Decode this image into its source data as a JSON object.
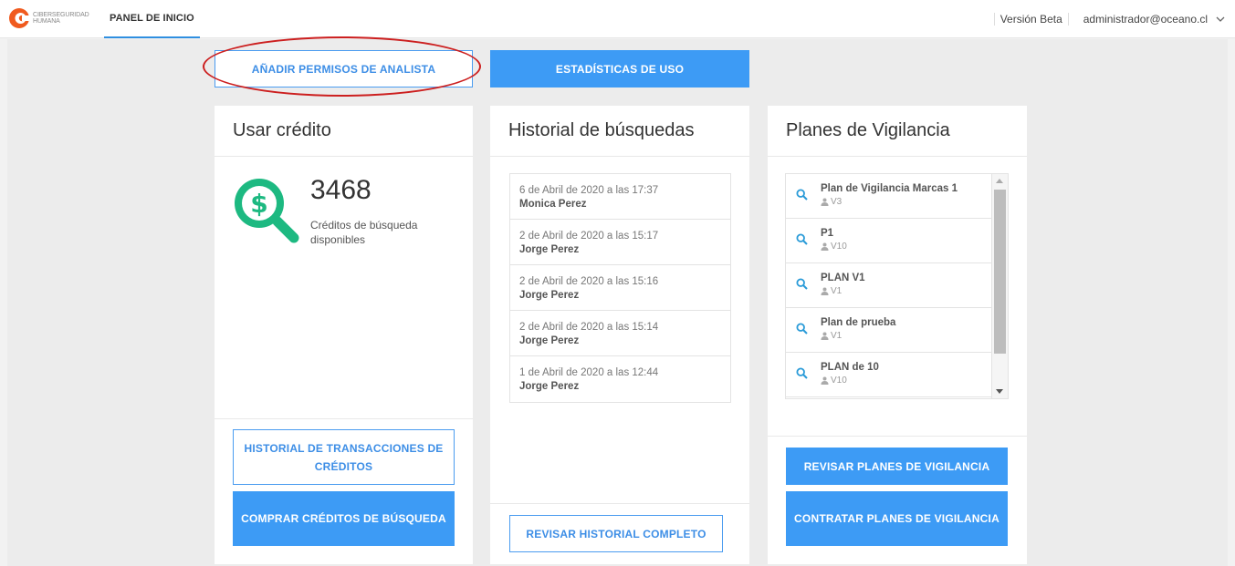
{
  "header": {
    "logo_line1": "CIBERSEGURIDAD",
    "logo_line2": "HUMANA",
    "nav_tab": "PANEL DE INICIO",
    "version": "Versión Beta",
    "user_email": "administrador@oceano.cl"
  },
  "actions": {
    "add_analyst": "AÑADIR PERMISOS DE ANALISTA",
    "usage_stats": "ESTADÍSTICAS DE USO"
  },
  "credit_card": {
    "title": "Usar crédito",
    "amount": "3468",
    "description": "Créditos de búsqueda disponibles",
    "history_button": "HISTORIAL DE TRANSACCIONES DE CRÉDITOS",
    "buy_button": "COMPRAR CRÉDITOS DE BÚSQUEDA"
  },
  "history_card": {
    "title": "Historial de búsquedas",
    "items": [
      {
        "date": "6 de Abril de 2020 a las 17:37",
        "user": "Monica Perez"
      },
      {
        "date": "2 de Abril de 2020 a las 15:17",
        "user": "Jorge Perez"
      },
      {
        "date": "2 de Abril de 2020 a las 15:16",
        "user": "Jorge Perez"
      },
      {
        "date": "2 de Abril de 2020 a las 15:14",
        "user": "Jorge Perez"
      },
      {
        "date": "1 de Abril de 2020 a las 12:44",
        "user": "Jorge Perez"
      }
    ],
    "full_history_button": "REVISAR HISTORIAL COMPLETO"
  },
  "plans_card": {
    "title": "Planes de Vigilancia",
    "items": [
      {
        "name": "Plan de Vigilancia Marcas 1",
        "code": "V3"
      },
      {
        "name": "P1",
        "code": "V10"
      },
      {
        "name": "PLAN V1",
        "code": "V1"
      },
      {
        "name": "Plan de prueba",
        "code": "V1"
      },
      {
        "name": "PLAN de 10",
        "code": "V10"
      }
    ],
    "review_button": "REVISAR PLANES DE VIGILANCIA",
    "hire_button": "CONTRATAR PLANES DE VIGILANCIA"
  },
  "colors": {
    "accent_blue": "#3d9bf5",
    "credit_green": "#1db981",
    "highlight_red": "#cc1f1f",
    "logo_orange": "#f05a1e"
  },
  "icons": {
    "logo": "ciberseguridad-logo-icon",
    "credit": "dollar-magnifier-icon",
    "plan": "search-icon",
    "person": "person-icon",
    "chevron": "chevron-down-icon"
  }
}
